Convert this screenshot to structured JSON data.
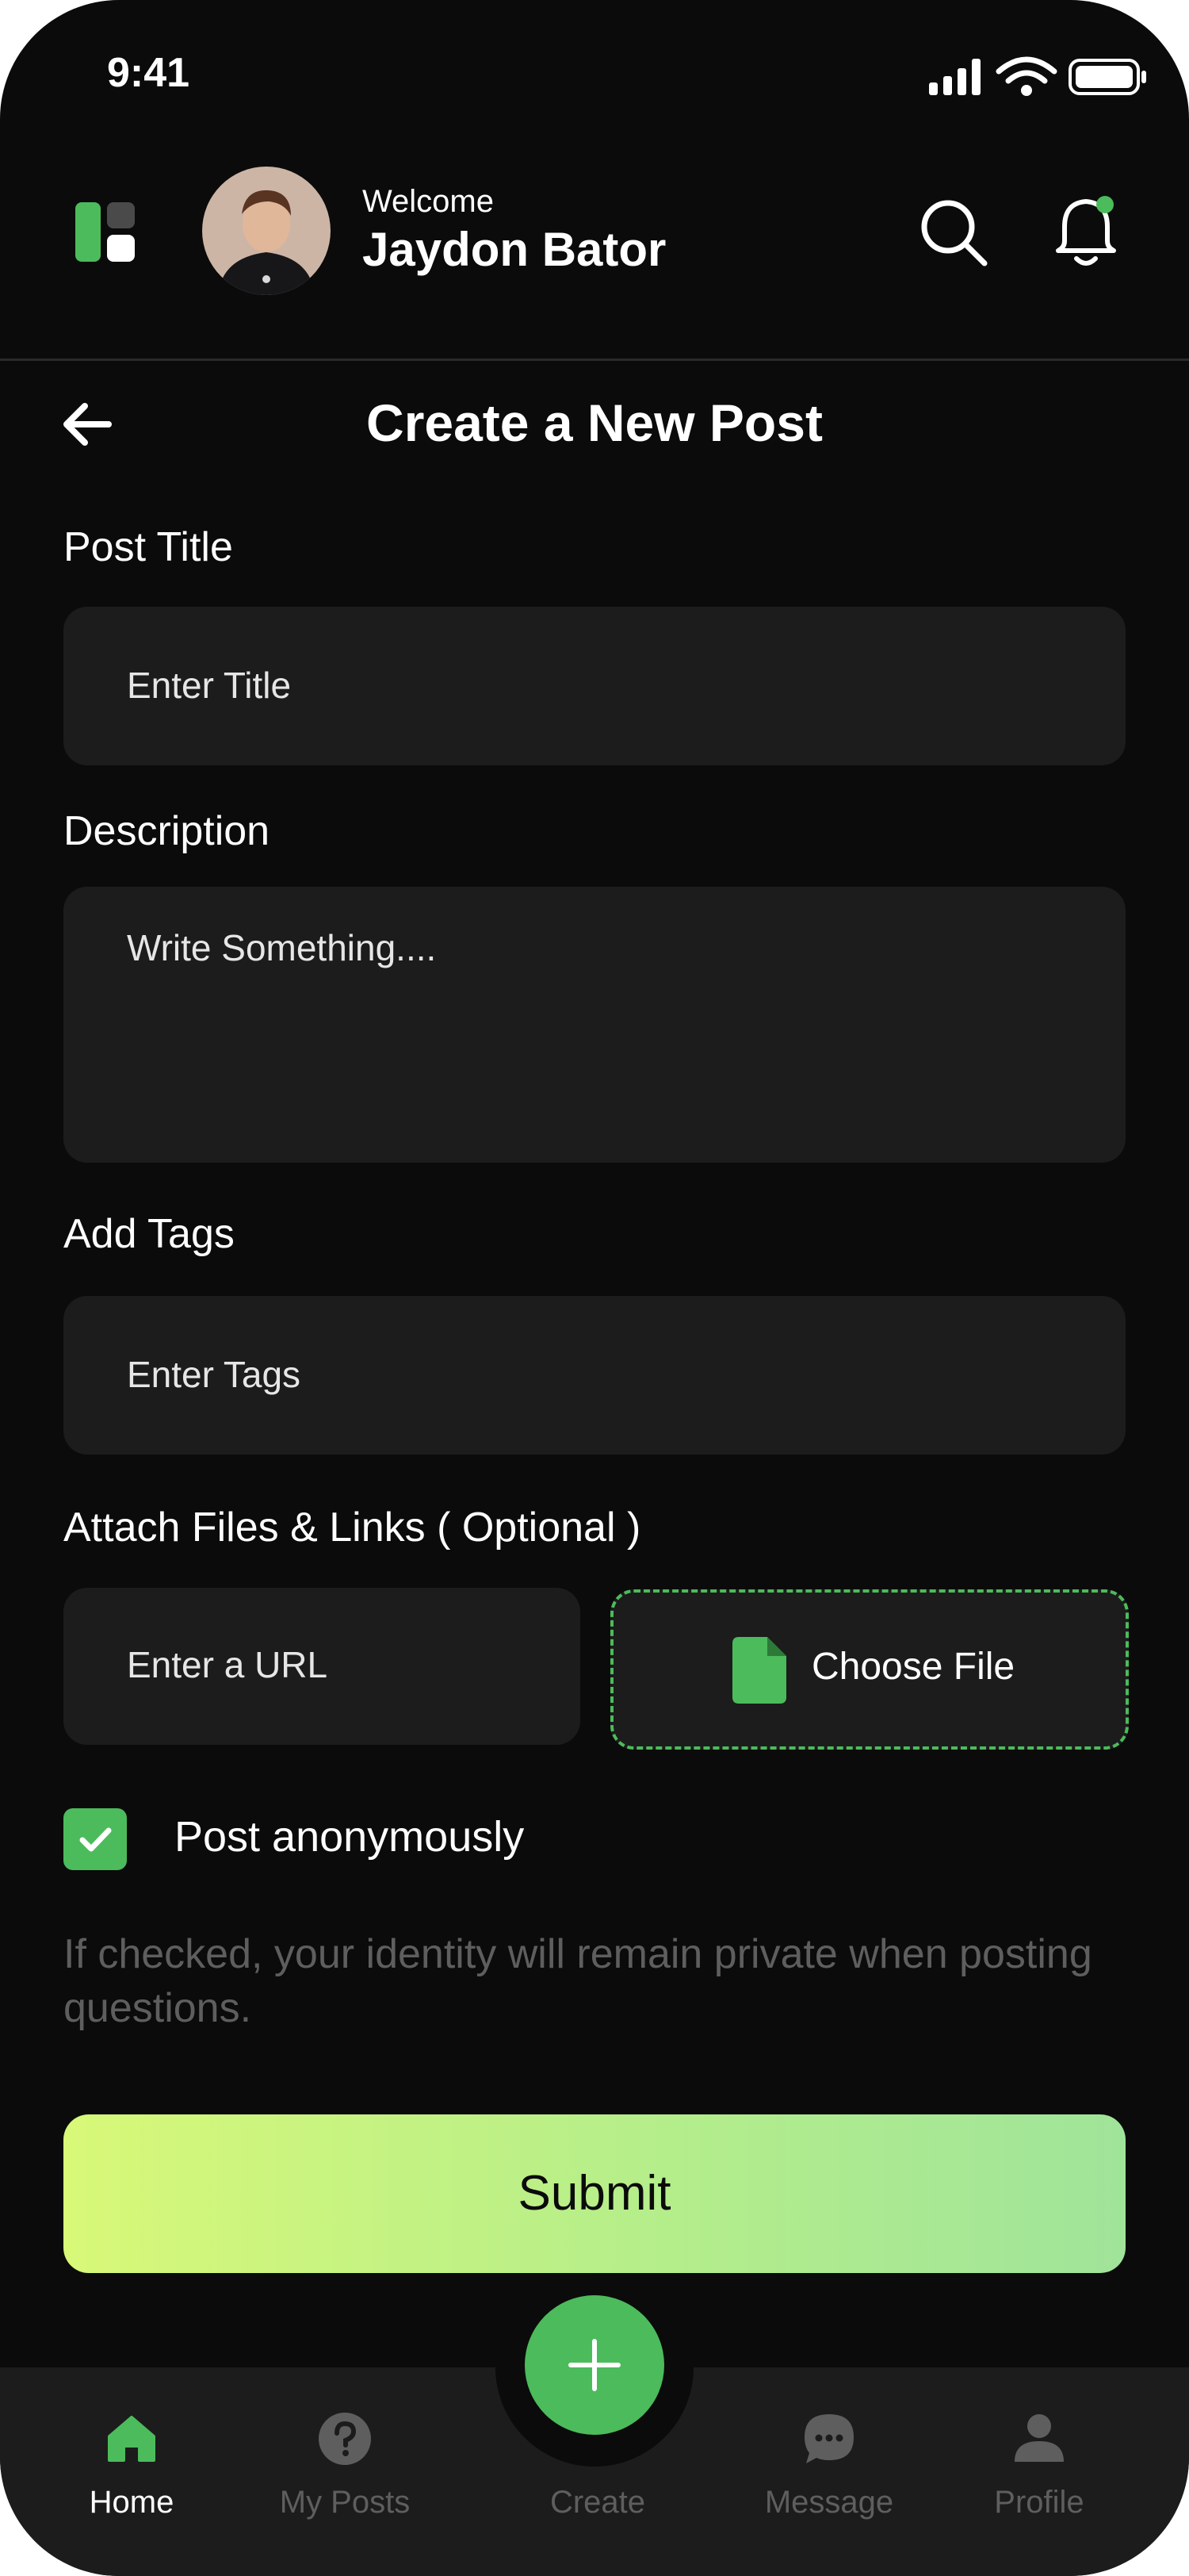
{
  "status_bar": {
    "time": "9:41"
  },
  "header": {
    "welcome": "Welcome",
    "user_name": "Jaydon Bator"
  },
  "page": {
    "title": "Create a New Post"
  },
  "form": {
    "post_title": {
      "label": "Post Title",
      "placeholder": "Enter Title"
    },
    "description": {
      "label": "Description",
      "placeholder": "Write Something...."
    },
    "tags": {
      "label": "Add Tags",
      "placeholder": "Enter Tags"
    },
    "attachments": {
      "label": "Attach Files & Links ( Optional )",
      "url_placeholder": "Enter a URL",
      "choose_file": "Choose File"
    },
    "anonymous": {
      "label": "Post anonymously",
      "checked": true,
      "note": "If checked, your identity will remain private when posting questions."
    },
    "submit": "Submit"
  },
  "nav": {
    "items": [
      {
        "label": "Home",
        "icon": "home-icon",
        "active": true
      },
      {
        "label": "My Posts",
        "icon": "question-icon",
        "active": false
      },
      {
        "label": "Create",
        "icon": "plus-icon",
        "active": false
      },
      {
        "label": "Message",
        "icon": "chat-icon",
        "active": false
      },
      {
        "label": "Profile",
        "icon": "user-icon",
        "active": false
      }
    ]
  },
  "colors": {
    "accent": "#4cbb5b",
    "background": "#0b0b0b",
    "field": "#1c1c1c",
    "muted": "#5e5e5e"
  }
}
